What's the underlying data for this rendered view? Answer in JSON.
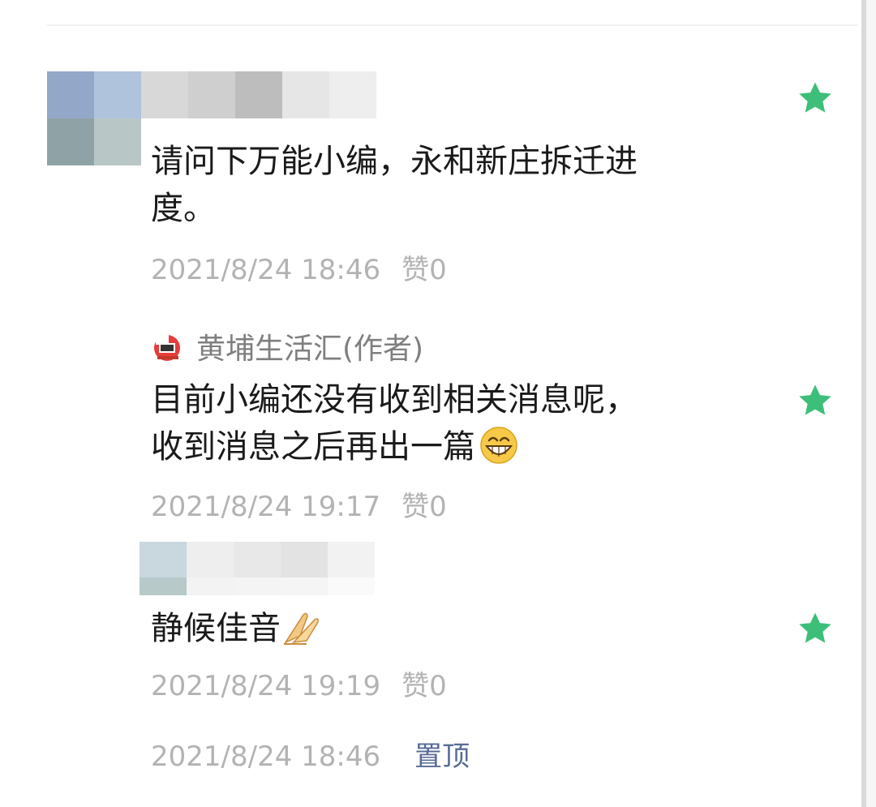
{
  "comments": [
    {
      "text_line1": "请问下万能小编，永和新庄拆迁进",
      "text_line2": "度。",
      "time": "2021/8/24 18:46",
      "likes": "赞0",
      "starred": true
    },
    {
      "time": "2021/8/24 19:19",
      "likes": "赞0",
      "text": "静候佳音",
      "emoji": "folded-hands",
      "starred": true
    }
  ],
  "author_reply": {
    "author": "黄埔生活汇(作者)",
    "avatar": "huangpu-logo",
    "text_line1": "目前小编还没有收到相关消息呢，",
    "text_line2": "收到消息之后再出一篇",
    "emoji": "grinning-face",
    "time": "2021/8/24 19:17",
    "likes": "赞0",
    "starred": true
  },
  "footer": {
    "time": "2021/8/24 18:46",
    "pin_label": "置顶"
  },
  "colors": {
    "star": "#3dbf7a",
    "link": "#576b95",
    "meta": "#b3b3b3"
  }
}
